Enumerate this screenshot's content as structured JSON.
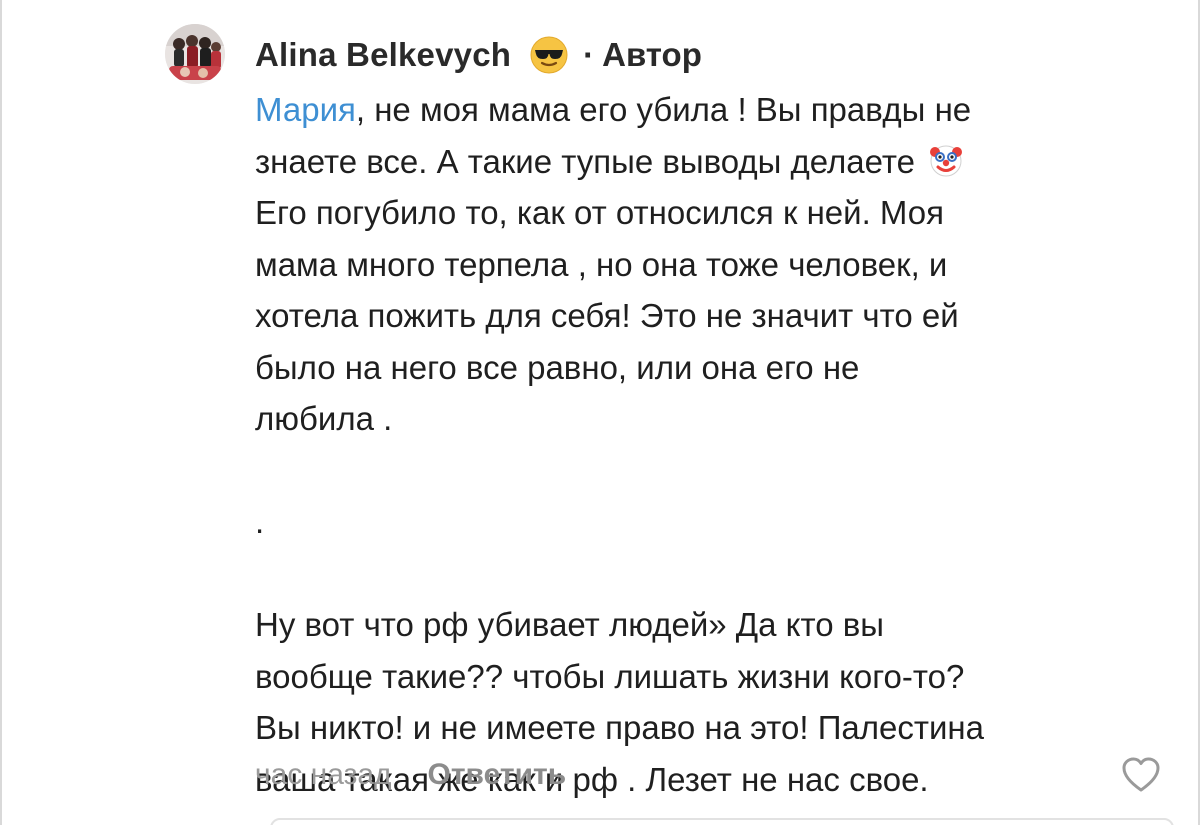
{
  "comment": {
    "author": "Alina Belkevych",
    "author_emoji": "sunglasses-face-icon",
    "separator": "·",
    "role": "Автор",
    "mention": "Мария",
    "lines": [
      ", не моя мама его убила ! Вы правды не",
      "знаете все. А такие тупые выводы делаете",
      "Его погубило то,  как от относился к ней. Моя",
      "мама много терпела , но она тоже человек, и",
      "хотела пожить для себя! Это не значит что ей",
      "было на него все равно, или она его не",
      "любила .",
      ".",
      "Ну вот что рф убивает людей» Да кто вы",
      "вообще такие??  чтобы лишать жизни кого-то?",
      "Вы никто! и не имеете право на это! Палестина",
      "ваша такая же как и рф . Лезет не нас свое."
    ],
    "inline_emoji": "clown-face-icon",
    "time": "час назад",
    "reply_label": "Ответить",
    "like_icon": "heart-outline-icon"
  },
  "colors": {
    "mention": "#3e8fd3",
    "meta": "#9a9a9a",
    "text": "#1f1f1f"
  }
}
